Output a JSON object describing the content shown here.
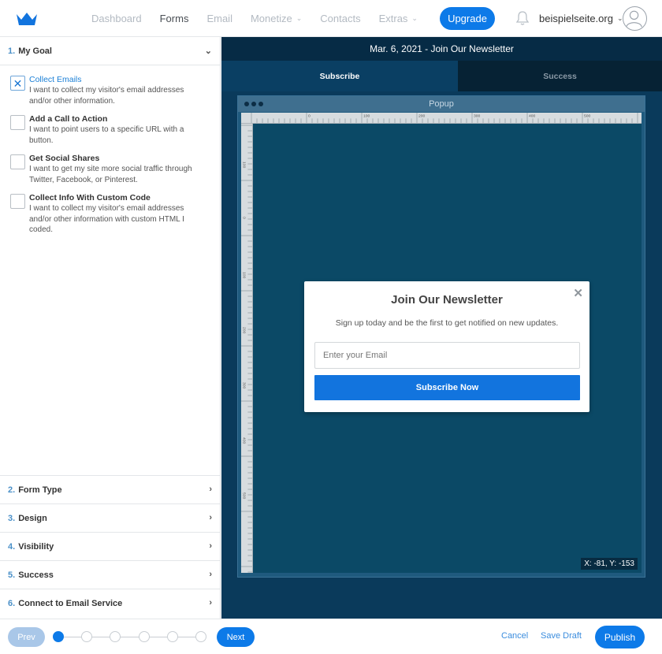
{
  "app": {
    "logo_icon": "crown-icon",
    "nav": [
      {
        "label": "Dashboard",
        "active": false
      },
      {
        "label": "Forms",
        "active": true
      },
      {
        "label": "Email",
        "active": false
      },
      {
        "label": "Monetize",
        "active": false,
        "dropdown": true
      },
      {
        "label": "Contacts",
        "active": false
      },
      {
        "label": "Extras",
        "active": false,
        "dropdown": true
      }
    ],
    "upgrade_label": "Upgrade",
    "site_name": "beispielseite.org",
    "accent": "#0d7ae8"
  },
  "left_panel": {
    "goal_section": {
      "num": "1.",
      "label": "My Goal"
    },
    "goals": [
      {
        "title": "Collect Emails",
        "desc": "I want to collect my visitor's email addresses and/or other information.",
        "checked": true
      },
      {
        "title": "Add a Call to Action",
        "desc": "I want to point users to a specific URL with a button.",
        "checked": false
      },
      {
        "title": "Get Social Shares",
        "desc": "I want to get my site more social traffic through Twitter, Facebook, or Pinterest.",
        "checked": false
      },
      {
        "title": "Collect Info With Custom Code",
        "desc": "I want to collect my visitor's email addresses and/or other information with custom HTML I coded.",
        "checked": false
      }
    ],
    "sections": [
      {
        "num": "2.",
        "label": "Form Type"
      },
      {
        "num": "3.",
        "label": "Design"
      },
      {
        "num": "4.",
        "label": "Visibility"
      },
      {
        "num": "5.",
        "label": "Success"
      },
      {
        "num": "6.",
        "label": "Connect to Email Service"
      }
    ]
  },
  "editor": {
    "title": "Mar. 6, 2021 - Join Our Newsletter",
    "tabs": [
      {
        "label": "Subscribe",
        "active": true
      },
      {
        "label": "Success",
        "active": false
      }
    ],
    "frame_title": "Popup",
    "ruler_top_labels": [
      "0",
      "100",
      "200",
      "300",
      "400",
      "500"
    ],
    "ruler_left_labels": [
      "100",
      "0",
      "100",
      "200",
      "300",
      "400",
      "500"
    ],
    "coords": "X: -81, Y: -153"
  },
  "modal": {
    "title": "Join Our Newsletter",
    "subtitle": "Sign up today and be the first to get notified on new updates.",
    "email_placeholder": "Enter your Email",
    "button_label": "Subscribe Now",
    "close_icon": "close-icon"
  },
  "footer": {
    "prev_label": "Prev",
    "next_label": "Next",
    "cancel_label": "Cancel",
    "draft_label": "Save Draft",
    "publish_label": "Publish",
    "steps_total": 6,
    "current_step": 1
  }
}
